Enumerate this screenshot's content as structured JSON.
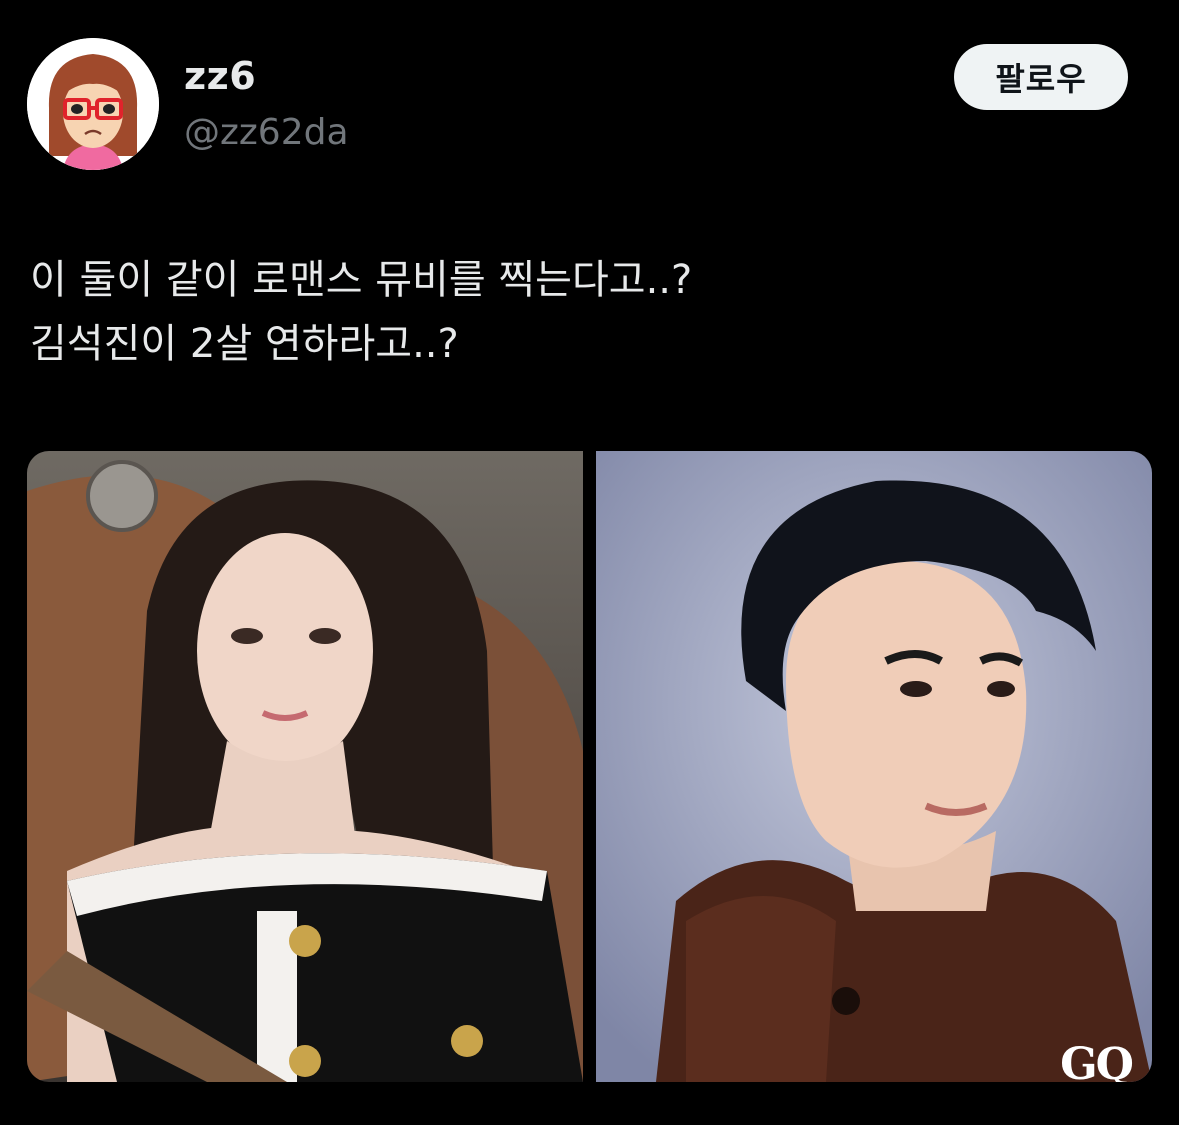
{
  "author": {
    "display_name": "zz6",
    "handle": "@zz62da",
    "avatar_icon": "mii-avatar-icon"
  },
  "follow_button": {
    "label": "팔로우"
  },
  "tweet": {
    "lines": [
      "이 둘이 같이 로맨스 뮤비를 찍는다고..?",
      "김석진이 2살 연하라고..?"
    ]
  },
  "media": {
    "right_photo_watermark": "GQ"
  },
  "colors": {
    "background": "#000000",
    "text_primary": "#e7e9ea",
    "text_secondary": "#71767b",
    "button_bg": "#eff3f4",
    "button_text": "#0f1419"
  }
}
